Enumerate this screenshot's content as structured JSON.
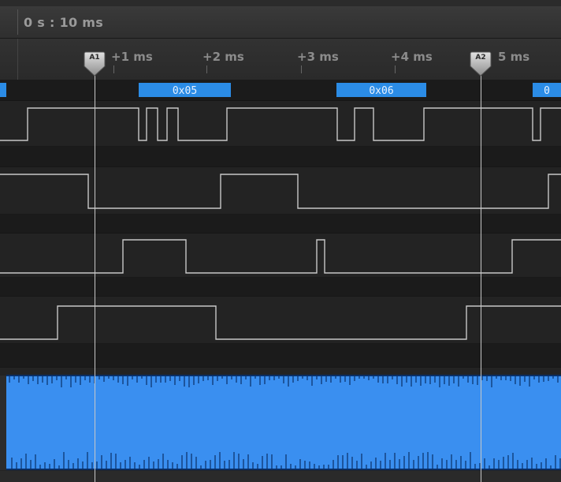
{
  "header": {
    "time_offset": "0 s : 10 ms"
  },
  "ruler": {
    "ticks": [
      {
        "label": "+1 ms"
      },
      {
        "label": "+2 ms"
      },
      {
        "label": "+3 ms"
      },
      {
        "label": "+4 ms"
      },
      {
        "label": "5 ms"
      }
    ]
  },
  "cursors": [
    {
      "label": "A1"
    },
    {
      "label": "A2"
    }
  ],
  "decoder": {
    "packets": [
      {
        "label": ""
      },
      {
        "label": "0x05"
      },
      {
        "label": "0x06"
      },
      {
        "label": "0"
      }
    ],
    "packet_color": "#2b8ce6"
  },
  "colors": {
    "background": "#1f1f1f",
    "channel_bg": "#232323",
    "waveform": "#c8c8c8",
    "analog_fill": "#3a8ff0",
    "analog_edge": "#0a2f66",
    "cursor": "#c8c8c8"
  }
}
